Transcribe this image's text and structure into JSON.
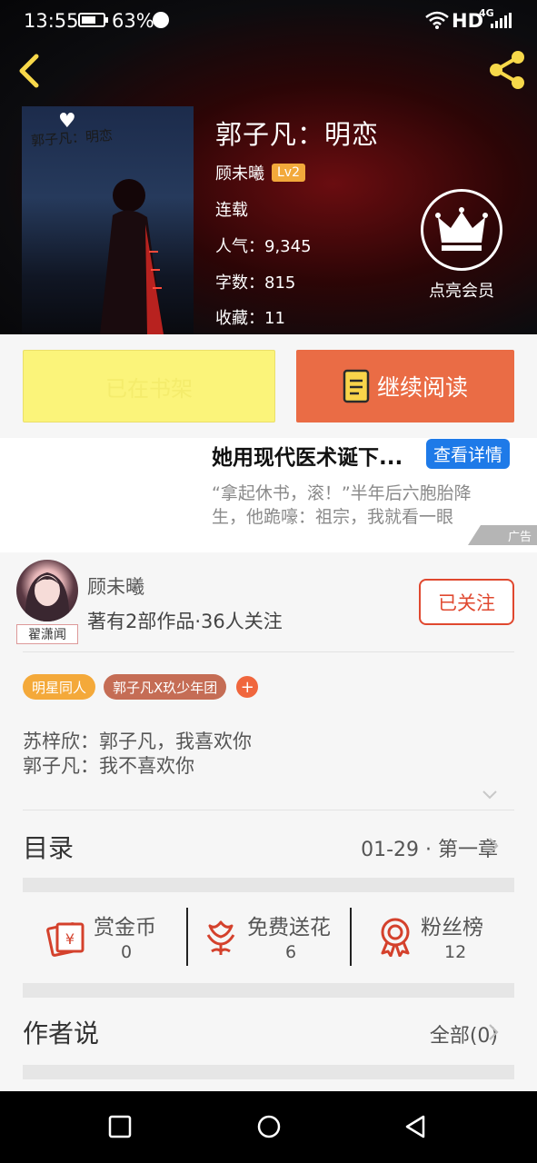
{
  "status_bar": {
    "time": "13:55",
    "battery": "63%",
    "network": "HD",
    "network_type": "4G"
  },
  "header": {
    "back_icon": "chevron-left-icon",
    "share_icon": "share-icon"
  },
  "book": {
    "cover_title": "郭子凡：明恋",
    "title": "郭子凡：明恋",
    "author": "顾未曦",
    "level": "Lv2",
    "status": "连载",
    "popularity": "人气：9,345",
    "word_count": "字数：815",
    "favorites": "收藏：11"
  },
  "vip": {
    "label": "点亮会员",
    "icon": "crown-icon"
  },
  "actions": {
    "shelf_label": "已在书架",
    "read_label": "继续阅读"
  },
  "ad": {
    "title": "她用现代医术诞下...",
    "button": "查看详情",
    "description": "“拿起休书，滚！”半年后六胞胎降生，他跪嚎：祖宗，我就看一眼",
    "tag": "广告"
  },
  "author_card": {
    "avatar_tag": "翟潇闻",
    "name": "顾未曦",
    "summary": "著有2部作品·36人关注",
    "follow_label": "已关注"
  },
  "tags": [
    "明星同人",
    "郭子凡X玖少年团"
  ],
  "intro": {
    "line1": "苏梓欣：郭子凡，我喜欢你",
    "line2": "郭子凡：我不喜欢你"
  },
  "catalog": {
    "title": "目录",
    "latest": "01-29 · 第一章"
  },
  "stats": [
    {
      "label": "赏金币",
      "value": "0",
      "icon": "reward-coin-icon"
    },
    {
      "label": "免费送花",
      "value": "6",
      "icon": "flower-icon"
    },
    {
      "label": "粉丝榜",
      "value": "12",
      "icon": "ribbon-medal-icon"
    }
  ],
  "author_says": {
    "title": "作者说",
    "all": "全部(0)"
  },
  "colors": {
    "accent_orange": "#ea6c45",
    "shelf_yellow": "#fbf47a",
    "follow_red": "#e0482f",
    "ad_blue": "#1e7ae8",
    "icon_red": "#d4412c"
  }
}
